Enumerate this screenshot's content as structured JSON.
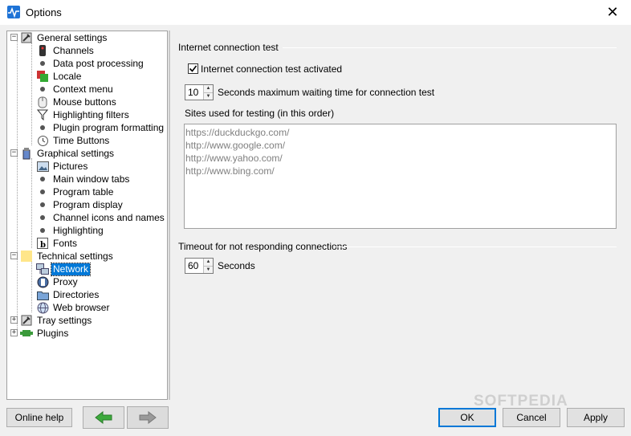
{
  "window": {
    "title": "Options",
    "close_glyph": "✕"
  },
  "tree": {
    "items": [
      {
        "label": "General settings",
        "icon": "wrench-settings-icon"
      },
      {
        "label": "Channels",
        "icon": "remote-control-icon"
      },
      {
        "label": "Data post processing",
        "icon": "bullet-icon"
      },
      {
        "label": "Locale",
        "icon": "locale-icon"
      },
      {
        "label": "Context menu",
        "icon": "bullet-icon"
      },
      {
        "label": "Mouse buttons",
        "icon": "mouse-icon"
      },
      {
        "label": "Highlighting filters",
        "icon": "filter-icon"
      },
      {
        "label": "Plugin program formatting",
        "icon": "bullet-icon"
      },
      {
        "label": "Time Buttons",
        "icon": "clock-icon"
      },
      {
        "label": "Graphical settings",
        "icon": "paint-bucket-icon"
      },
      {
        "label": "Pictures",
        "icon": "picture-icon"
      },
      {
        "label": "Main window tabs",
        "icon": "bullet-icon"
      },
      {
        "label": "Program table",
        "icon": "bullet-icon"
      },
      {
        "label": "Program display",
        "icon": "bullet-icon"
      },
      {
        "label": "Channel icons and names",
        "icon": "bullet-icon"
      },
      {
        "label": "Highlighting",
        "icon": "bullet-icon"
      },
      {
        "label": "Fonts",
        "icon": "font-icon"
      },
      {
        "label": "Technical settings",
        "icon": "folder-icon"
      },
      {
        "label": "Network",
        "icon": "network-icon"
      },
      {
        "label": "Proxy",
        "icon": "proxy-icon"
      },
      {
        "label": "Directories",
        "icon": "directory-icon"
      },
      {
        "label": "Web browser",
        "icon": "globe-icon"
      },
      {
        "label": "Tray settings",
        "icon": "wrench-settings-icon"
      },
      {
        "label": "Plugins",
        "icon": "plugin-icon"
      }
    ],
    "selected": "Network"
  },
  "network": {
    "section_test_title": "Internet connection test",
    "test_activated_label": "Internet connection test activated",
    "test_activated_checked": true,
    "max_wait_value": "10",
    "max_wait_label": "Seconds maximum waiting time for connection test",
    "sites_label": "Sites used for testing (in this order)",
    "sites": [
      "https://duckduckgo.com/",
      "http://www.google.com/",
      "http://www.yahoo.com/",
      "http://www.bing.com/"
    ],
    "section_timeout_title": "Timeout for not responding connections",
    "timeout_value": "60",
    "timeout_label": "Seconds"
  },
  "buttons": {
    "online_help": "Online help",
    "ok": "OK",
    "cancel": "Cancel",
    "apply": "Apply"
  },
  "watermark": "SOFTPEDIA",
  "colors": {
    "selection": "#0078d7",
    "back_arrow": "#3daa3d",
    "forward_arrow": "#9a9a9a"
  }
}
